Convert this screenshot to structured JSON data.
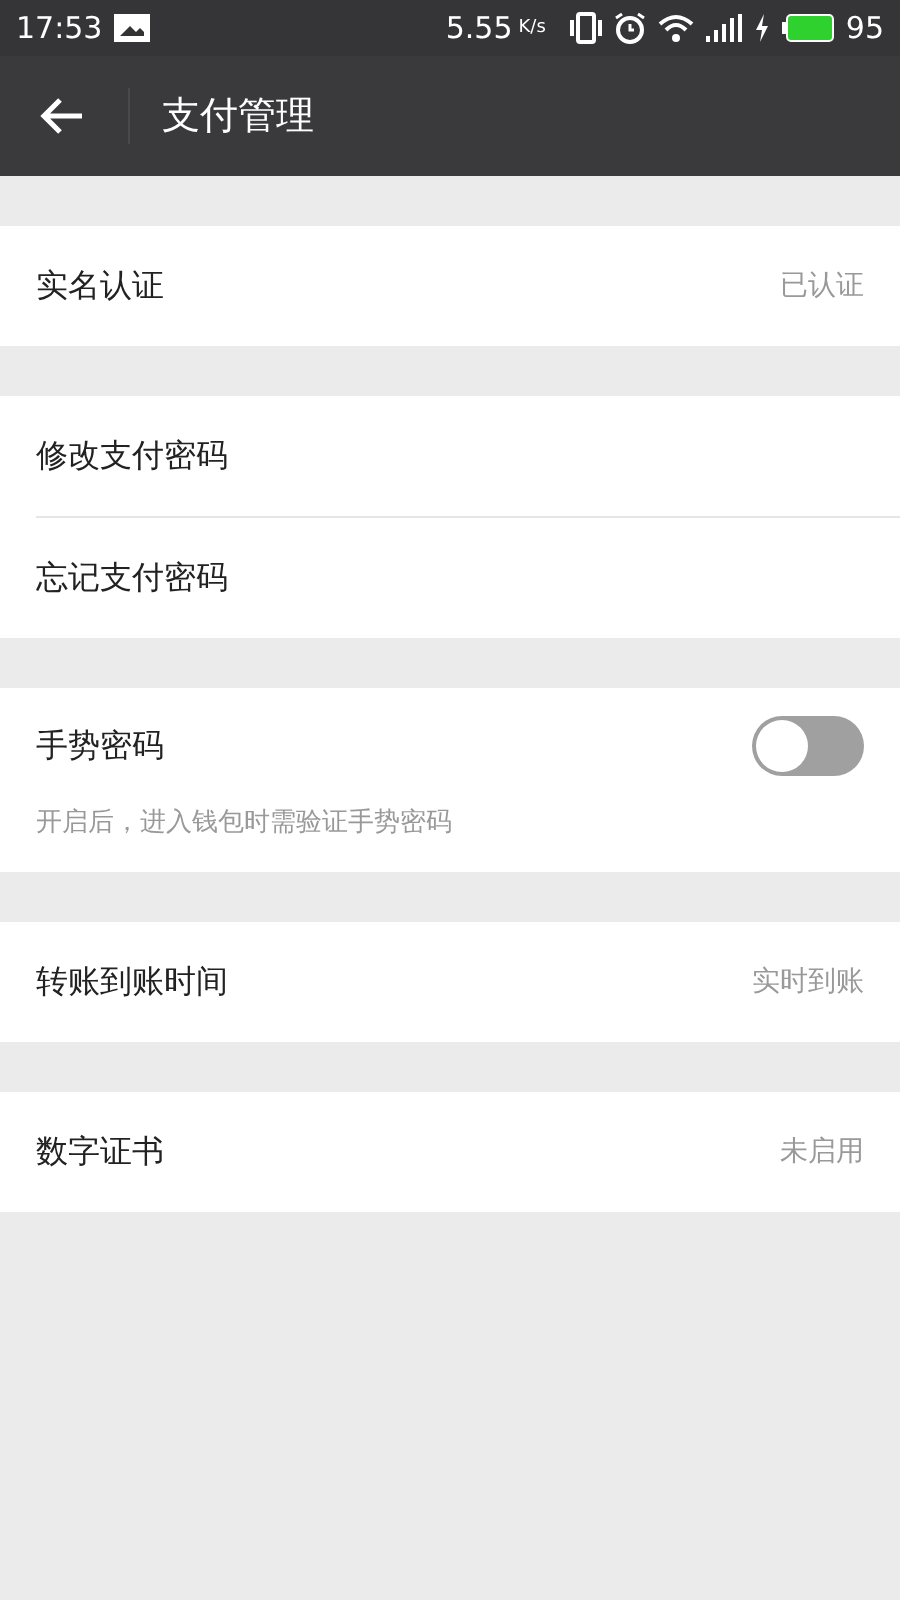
{
  "status_bar": {
    "time": "17:53",
    "speed": "5.55",
    "speed_unit": "K/s",
    "battery": "95"
  },
  "header": {
    "title": "支付管理"
  },
  "groups": [
    [
      {
        "kind": "value",
        "label": "实名认证",
        "value": "已认证"
      }
    ],
    [
      {
        "kind": "link",
        "label": "修改支付密码"
      },
      {
        "kind": "link",
        "label": "忘记支付密码"
      }
    ],
    [
      {
        "kind": "toggle",
        "label": "手势密码",
        "on": false,
        "hint": "开启后，进入钱包时需验证手势密码"
      }
    ],
    [
      {
        "kind": "value",
        "label": "转账到账时间",
        "value": "实时到账"
      }
    ],
    [
      {
        "kind": "value",
        "label": "数字证书",
        "value": "未启用"
      }
    ]
  ]
}
